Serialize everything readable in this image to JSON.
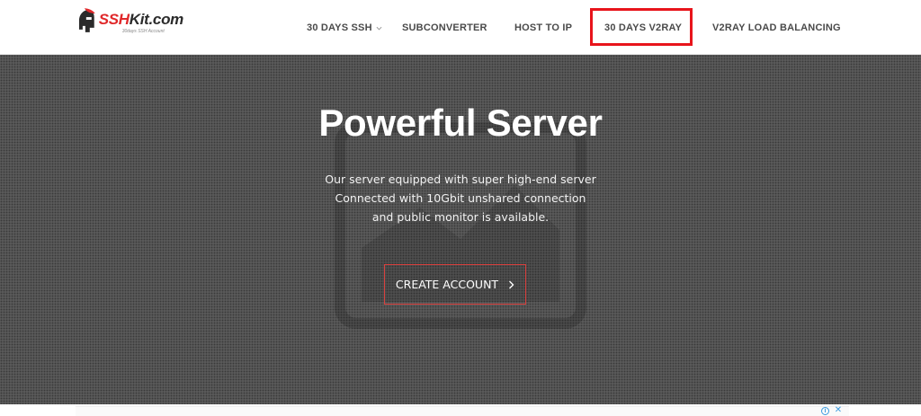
{
  "brand": {
    "logo_text_prefix": "SSH",
    "logo_text_suffix": "Kit.com",
    "tagline": "30days SSH Account"
  },
  "nav": {
    "items": [
      {
        "label": "30 DAYS SSH",
        "has_dropdown": true
      },
      {
        "label": "SUBCONVERTER",
        "has_dropdown": false
      },
      {
        "label": "HOST TO IP",
        "has_dropdown": false
      },
      {
        "label": "30 DAYS V2RAY",
        "has_dropdown": false,
        "highlighted": true
      },
      {
        "label": "V2RAY LOAD BALANCING",
        "has_dropdown": false
      }
    ]
  },
  "hero": {
    "title": "Powerful Server",
    "description_lines": [
      "Our server equipped with super high-end server",
      "Connected with 10Gbit unshared connection",
      "and public monitor is available."
    ],
    "cta_label": "CREATE ACCOUNT"
  },
  "ad": {
    "info_icon": "info-icon",
    "close_icon": "close-icon",
    "info_glyph": "i",
    "close_glyph": "✕"
  },
  "colors": {
    "accent_red": "#e8141b",
    "hero_bg": "#595959",
    "nav_text": "#4a4a4a"
  }
}
